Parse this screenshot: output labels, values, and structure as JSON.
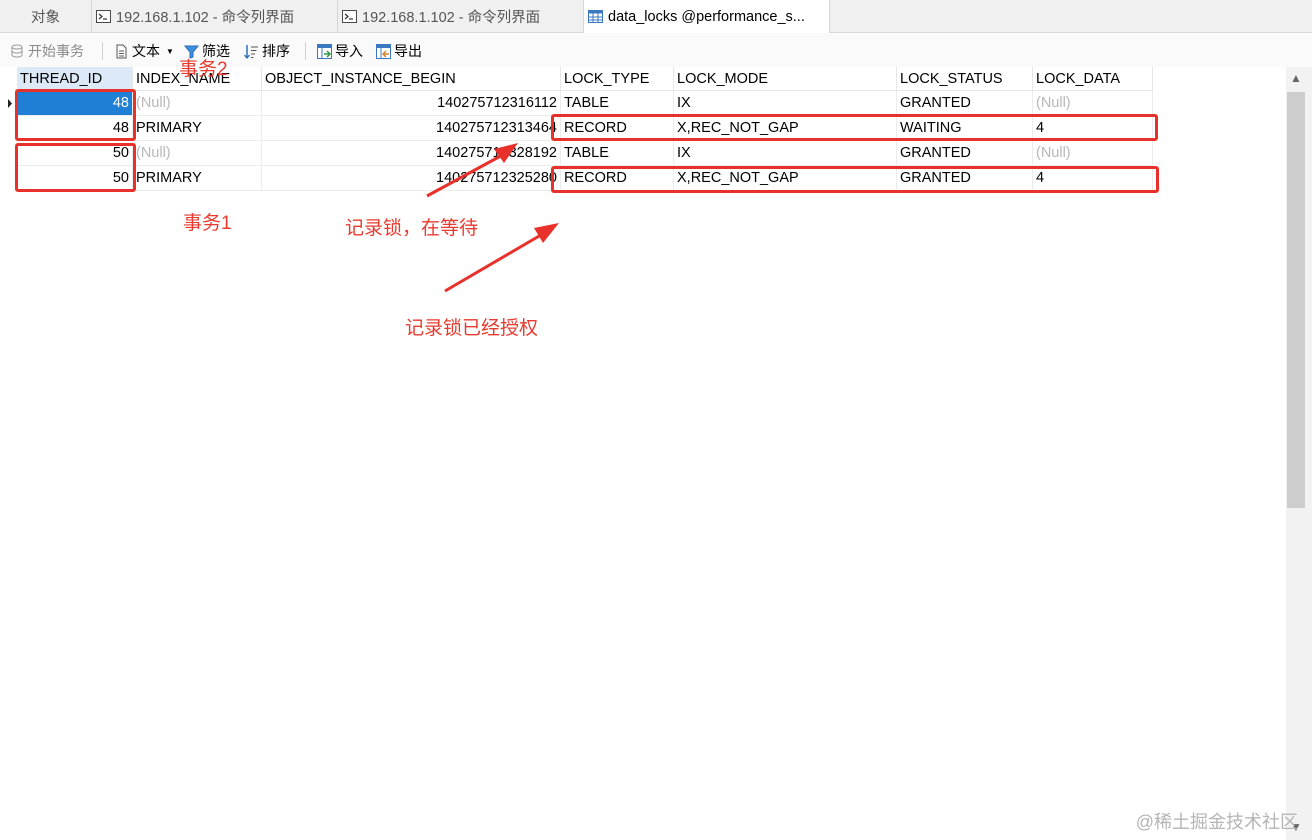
{
  "tabs": [
    {
      "label": "对象",
      "icon": "none"
    },
    {
      "label": "192.168.1.102 - 命令列界面",
      "icon": "terminal-icon"
    },
    {
      "label": "192.168.1.102 - 命令列界面",
      "icon": "terminal-icon"
    },
    {
      "label": "data_locks @performance_s...",
      "icon": "table-icon"
    }
  ],
  "toolbar": {
    "begin_tx": "开始事务",
    "text": "文本",
    "filter": "筛选",
    "sort": "排序",
    "import": "导入",
    "export": "导出"
  },
  "grid": {
    "columns": [
      "THREAD_ID",
      "INDEX_NAME",
      "OBJECT_INSTANCE_BEGIN",
      "LOCK_TYPE",
      "LOCK_MODE",
      "LOCK_STATUS",
      "LOCK_DATA"
    ],
    "rows": [
      [
        "48",
        "(Null)",
        "140275712316112",
        "TABLE",
        "IX",
        "GRANTED",
        "(Null)"
      ],
      [
        "48",
        "PRIMARY",
        "140275712313464",
        "RECORD",
        "X,REC_NOT_GAP",
        "WAITING",
        "4"
      ],
      [
        "50",
        "(Null)",
        "140275712328192",
        "TABLE",
        "IX",
        "GRANTED",
        "(Null)"
      ],
      [
        "50",
        "PRIMARY",
        "140275712325280",
        "RECORD",
        "X,REC_NOT_GAP",
        "GRANTED",
        "4"
      ]
    ]
  },
  "annotations": {
    "tx2": "事务2",
    "tx1": "事务1",
    "waiting": "记录锁，在等待",
    "granted": "记录锁已经授权"
  },
  "colors": {
    "annotation": "#e8312a",
    "selection": "#1e7fd4",
    "null_text": "#b8b8b8"
  },
  "watermark": "@稀土掘金技术社区"
}
